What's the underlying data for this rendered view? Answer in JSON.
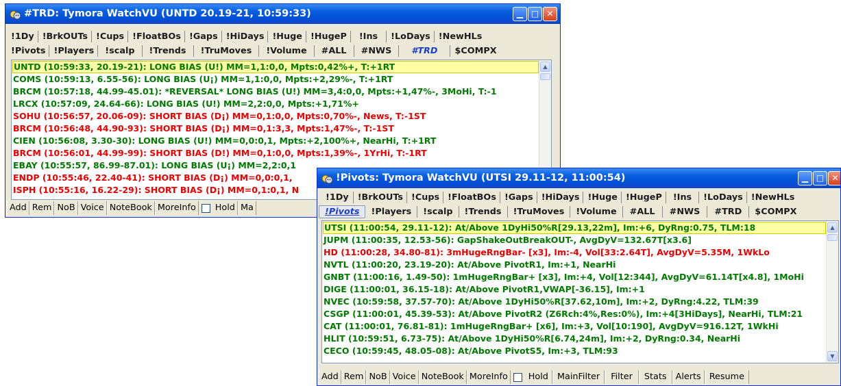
{
  "window1": {
    "title": "#TRD: Tymora WatchVU  (UNTD  20.19-21, 10:59:33)",
    "tabs_row1": [
      "!1Dy",
      "!BrkOUTs",
      "!Cups",
      "!FloatBOs",
      "!Gaps",
      "!HiDays",
      "!Huge",
      "!HugeP",
      "!Ins",
      "!LoDays",
      "!NewHLs"
    ],
    "tabs_row2": [
      "!Pivots",
      "!Players",
      "!scalp",
      "!Trends",
      "!TruMoves",
      "!Volume",
      "#ALL",
      "#NWS",
      "#TRD",
      "$COMPX"
    ],
    "active_tab": "#TRD",
    "rows": [
      {
        "text": "UNTD (10:59:33, 20.19-21): LONG BIAS (U!) MM=1,1:0,0, Mpts:0,42%+, T:+1RT",
        "color": "#007b00",
        "selected": true
      },
      {
        "text": "COMS (10:59:13, 6.55-56): LONG BIAS (U¡) MM=1,1:0,0, Mpts:+2,29%-, T:+1RT",
        "color": "#007b00"
      },
      {
        "text": "BRCM (10:57:18, 44.99-45.01): *REVERSAL* LONG BIAS (U!) MM=3,4:0,0, Mpts:+1,47%-, 3MoHi, T:-1",
        "color": "#007b00"
      },
      {
        "text": "LRCX (10:57:09, 24.64-66): LONG BIAS (U!) MM=2,2:0,0, Mpts:+1,71%+",
        "color": "#007b00"
      },
      {
        "text": "SOHU (10:56:57, 20.06-09): SHORT BIAS (D¡) MM=0,1:0,0, Mpts:0,70%-, News, T:-1ST",
        "color": "#ee0000"
      },
      {
        "text": "BRCM (10:56:48, 44.90-93): SHORT BIAS (D¡) MM=0,1:3,3, Mpts:1,47%-, T:-1ST",
        "color": "#ee0000"
      },
      {
        "text": "CIEN (10:56:08, 3.30-30): LONG BIAS (U!) MM=0,0:0,1, Mpts:+2,100%+, NearHi, T:+1RT",
        "color": "#007b00"
      },
      {
        "text": "BRCM (10:56:01, 44.99-99): SHORT BIAS (D!) MM=0,1:0,0, Mpts:1,39%-, 1YrHi, T:-1RT",
        "color": "#ee0000"
      },
      {
        "text": "EBAY (10:55:57, 86.99-87.01): LONG BIAS (U¡) MM=2,2:0,1",
        "color": "#007b00"
      },
      {
        "text": "ENDP (10:55:46, 22.40-41): SHORT BIAS (D¡) MM=0,0:0,1,",
        "color": "#ee0000"
      },
      {
        "text": "ISPH (10:55:16, 16.22-29): SHORT BIAS (D¡) MM=0,1:0,1, N",
        "color": "#ee0000"
      }
    ],
    "buttons": [
      "Add",
      "Rem",
      "NoB",
      "Voice",
      "NoteBook",
      "MoreInfo",
      "Hold",
      "Ma"
    ]
  },
  "window2": {
    "title": "!Pivots: Tymora WatchVU  (UTSI  29.11-12, 11:00:54)",
    "tabs_row1": [
      "!1Dy",
      "!BrkOUTs",
      "!Cups",
      "!FloatBOs",
      "!Gaps",
      "!HiDays",
      "!Huge",
      "!HugeP",
      "!Ins",
      "!LoDays",
      "!NewHLs"
    ],
    "tabs_row2": [
      "!Pivots",
      "!Players",
      "!scalp",
      "!Trends",
      "!TruMoves",
      "!Volume",
      "#ALL",
      "#NWS",
      "#TRD",
      "$COMPX"
    ],
    "active_tab": "!Pivots",
    "rows": [
      {
        "text": "UTSI (11:00:54, 29.11-12): At/Above 1DyHi50%R[29.13,22m], Im:+6, DyRng:0.75, TLM:18",
        "color": "#007b00",
        "selected": true
      },
      {
        "text": "JUPM (11:00:35, 12.53-56): GapShakeOutBreakOUT-, AvgDyV=132.67T[x3.6]",
        "color": "#007b00"
      },
      {
        "text": "HD (11:00:28, 34.80-81): 3mHugeRngBar- [x3], Im:-4, Vol[33:2.64T], AvgDyV=5.35M, 1WkLo",
        "color": "#ee0000"
      },
      {
        "text": "NVTL (11:00:20, 23.19-20): At/Above PivotR1, Im:+1, NearHi",
        "color": "#007b00"
      },
      {
        "text": "GNBT (11:00:16, 1.49-50): 1mHugeRngBar+ [x3], Im:+4, Vol[12:344], AvgDyV=61.14T[x4.8], 1MoHi",
        "color": "#007b00"
      },
      {
        "text": "DIGE (11:00:01, 36.15-18): At/Above PivotR1,VWAP[-36.15], Im:+1",
        "color": "#007b00"
      },
      {
        "text": "NVEC (10:59:58, 37.57-70): At/Above 1DyHi50%R[37.62,10m], Im:+2, DyRng:4.22, TLM:39",
        "color": "#007b00"
      },
      {
        "text": "CSGP (11:00:01, 45.39-53): At/Above PivotR2 (Z6Rch:4%,Res:0%), Im:+4[3HiDays], NearHi, TLM:21",
        "color": "#007b00"
      },
      {
        "text": "CAT (11:00:01, 76.81-81): 1mHugeRngBar+ [x6], Im:+3, Vol[10:190], AvgDyV=916.12T, 1WkHi",
        "color": "#007b00"
      },
      {
        "text": "HLIT (10:59:51, 6.73-75): At/Above 1DyHi50%R[6.74,24m], Im:+2, DyRng:0.34, NearHi",
        "color": "#007b00"
      },
      {
        "text": "CECO (10:59:45, 48.05-08): At/Above PivotS5, Im:+3, TLM:93",
        "color": "#007b00"
      }
    ],
    "buttons": [
      "Add",
      "Rem",
      "NoB",
      "Voice",
      "NoteBook",
      "MoreInfo",
      "Hold",
      "MainFilter",
      "Filter",
      "Stats",
      "Alerts",
      "Resume"
    ]
  },
  "icons": {
    "app": "theater-mask-icon",
    "minimize": "minimize-icon",
    "maximize": "maximize-icon",
    "close": "close-icon",
    "scroll_up": "scroll-up-arrow-icon",
    "scroll_down": "scroll-down-arrow-icon"
  }
}
